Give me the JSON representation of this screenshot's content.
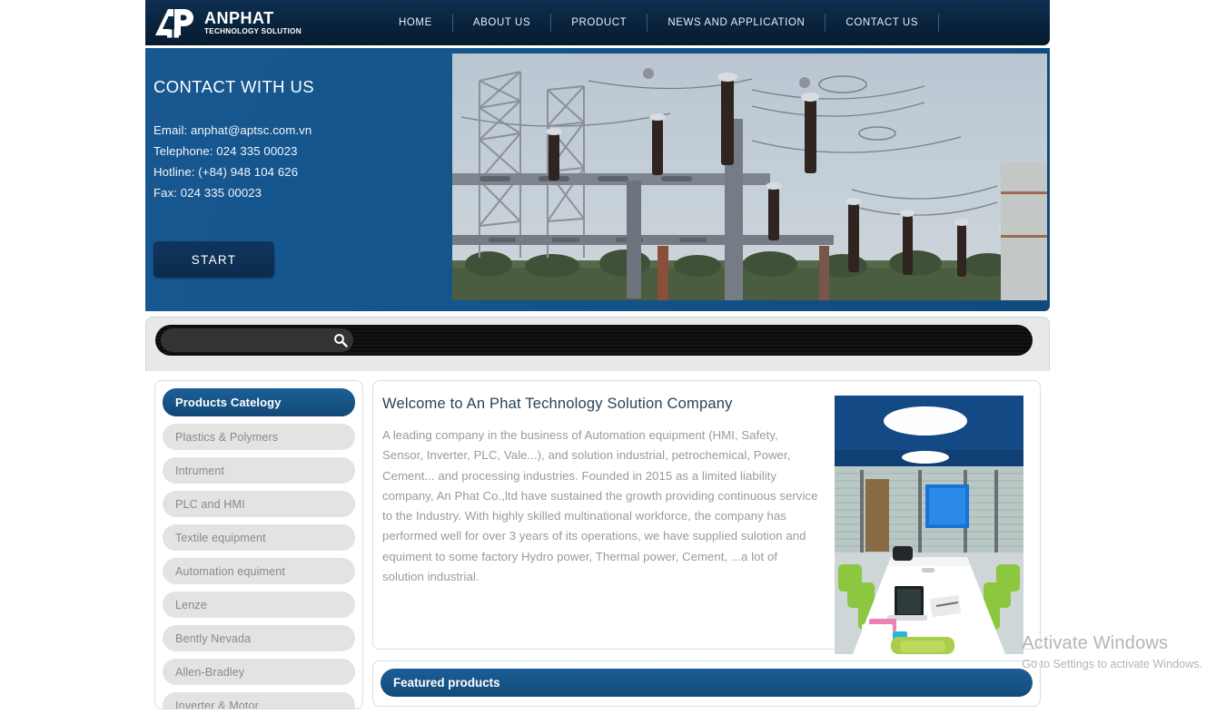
{
  "header": {
    "logo": {
      "name": "ANPHAT",
      "subtitle": "TECHNOLOGY SOLUTION",
      "mark_text": "AP"
    },
    "nav": [
      {
        "label": "HOME"
      },
      {
        "label": "ABOUT US"
      },
      {
        "label": "PRODUCT"
      },
      {
        "label": "NEWS AND APPLICATION"
      },
      {
        "label": "CONTACT US"
      }
    ]
  },
  "hero": {
    "title": "CONTACT WITH US",
    "lines": [
      "Email: anphat@aptsc.com.vn",
      "Telephone: 024 335 00023",
      "Hotline: (+84) 948 104 626",
      "Fax: 024 335 00023"
    ],
    "start_label": "START",
    "photo_alt": "electrical-substation-transmission-towers"
  },
  "search": {
    "value": "",
    "placeholder": "",
    "icon": "search-icon"
  },
  "sidebar": {
    "items": [
      {
        "label": "Products Catelogy",
        "active": true
      },
      {
        "label": "Plastics & Polymers",
        "active": false
      },
      {
        "label": "Intrument",
        "active": false
      },
      {
        "label": "PLC and HMI",
        "active": false
      },
      {
        "label": "Textile equipment",
        "active": false
      },
      {
        "label": "Automation equiment",
        "active": false
      },
      {
        "label": "Lenze",
        "active": false
      },
      {
        "label": "Bently Nevada",
        "active": false
      },
      {
        "label": "Allen-Bradley",
        "active": false
      },
      {
        "label": "Inverter & Motor",
        "active": false
      }
    ]
  },
  "main": {
    "welcome_title": "Welcome to An Phat Technology Solution Company",
    "welcome_body": "A leading company in the business of Automation equipment  (HMI, Safety, Sensor, Inverter, PLC, Vale...), and solution industrial, petrochemical, Power, Cement... and  processing industries. Founded in 2015 as a limited liability company, An Phat Co.,ltd have sustained the growth providing continuous service to the Industry. With highly skilled multinational workforce, the company has performed well for over 3 years of its operations, we have supplied sulotion and equiment to some factory Hydro power, Thermal power, Cement, ...a lot of solution industrial.",
    "office_photo_alt": "modern-conference-room-blue-ceiling-green-chairs",
    "featured_title": "Featured products"
  },
  "watermark": {
    "line1": "Activate Windows",
    "line2": "Go to Settings to activate Windows."
  },
  "colors": {
    "header_dark": "#0a2540",
    "hero_blue": "#14558c",
    "accent_blue": "#1b5e96",
    "category_gray": "#e3e3e3",
    "body_text": "#9a9a9a"
  }
}
